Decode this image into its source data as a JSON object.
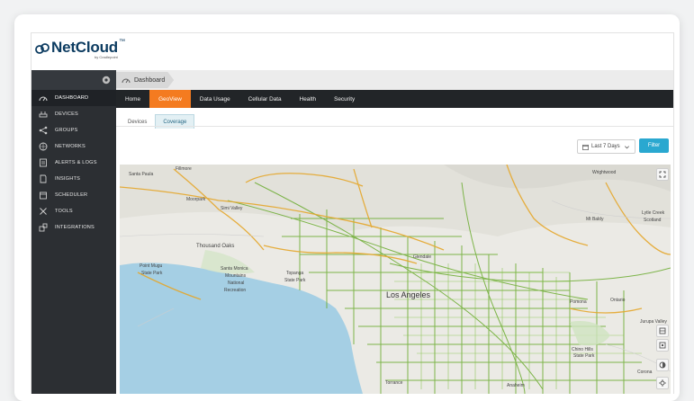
{
  "app": {
    "logo_text": "NetCloud",
    "logo_tm": "™",
    "logo_sub": "by Cradlepoint"
  },
  "sidebar": {
    "items": [
      {
        "label": "DASHBOARD",
        "icon": "dashboard-icon",
        "active": true
      },
      {
        "label": "DEVICES",
        "icon": "devices-icon"
      },
      {
        "label": "GROUPS",
        "icon": "groups-icon"
      },
      {
        "label": "NETWORKS",
        "icon": "networks-icon"
      },
      {
        "label": "ALERTS & LOGS",
        "icon": "alerts-icon"
      },
      {
        "label": "INSIGHTS",
        "icon": "insights-icon"
      },
      {
        "label": "SCHEDULER",
        "icon": "scheduler-icon"
      },
      {
        "label": "TOOLS",
        "icon": "tools-icon"
      },
      {
        "label": "INTEGRATIONS",
        "icon": "integrations-icon"
      }
    ]
  },
  "breadcrumb": {
    "label": "Dashboard"
  },
  "nav": {
    "tabs": [
      {
        "label": "Home"
      },
      {
        "label": "GeoView",
        "active": true
      },
      {
        "label": "Data Usage"
      },
      {
        "label": "Cellular Data"
      },
      {
        "label": "Health"
      },
      {
        "label": "Security"
      }
    ]
  },
  "subtabs": [
    {
      "label": "Devices"
    },
    {
      "label": "Coverage",
      "active": true
    }
  ],
  "filters": {
    "date_range": "Last 7 Days",
    "filter_label": "Filter"
  },
  "map": {
    "labels": {
      "santa_paula": "Santa Paula",
      "fillmore": "Fillmore",
      "moorpark": "Moorpark",
      "simi_valley": "Simi Valley",
      "thousand_oaks": "Thousand Oaks",
      "point_mugu": "Point Mugu",
      "point_mugu_2": "State Park",
      "santa_monica": "Santa Monica",
      "santa_monica_2": "Mountains",
      "santa_monica_3": "National",
      "santa_monica_4": "Recreation",
      "topanga": "Topanga",
      "topanga_2": "State Park",
      "los_angeles": "Los Angeles",
      "glendale": "Glendale",
      "wrightwood": "Wrightwood",
      "mt_baldy": "Mt Baldy",
      "lytle_creek": "Lytle Creek",
      "lytle_creek_2": "Scotland",
      "chino_hills": "Chino Hills",
      "chino_hills_2": "State Park",
      "torrance": "Torrance",
      "anaheim": "Anaheim",
      "jurupa": "Jurupa Valley",
      "ontario": "Ontario",
      "corona": "Corona",
      "pomona": "Pomona"
    },
    "colors": {
      "water": "#a5cfe4",
      "land": "#ebeae5",
      "coverage_good": "#6aab2e",
      "coverage_fair": "#e5a72b"
    }
  }
}
